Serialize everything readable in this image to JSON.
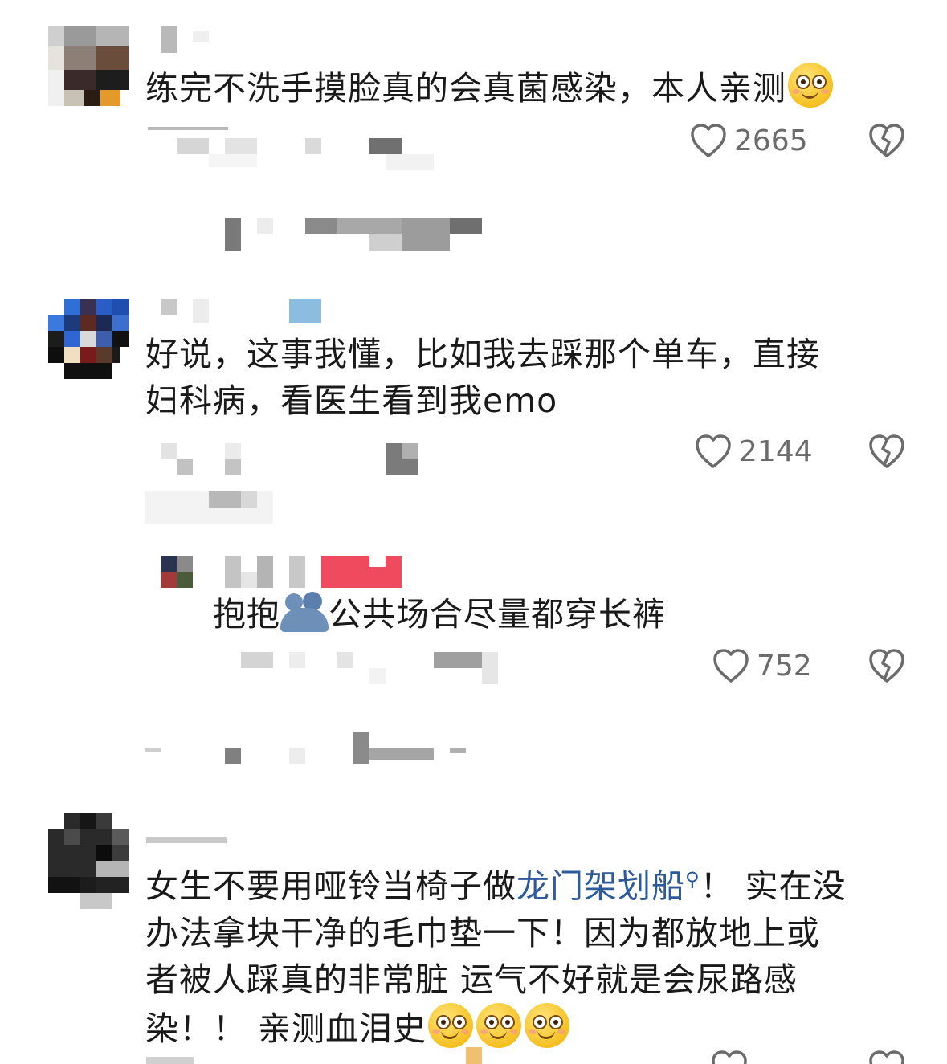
{
  "comments": [
    {
      "text": "练完不洗手摸脸真的会真菌感染，本人亲测",
      "emoji": "smiley-face-emoji",
      "likes": "2665"
    },
    {
      "line1": "好说，这事我懂，比如我去踩那个单车，直接",
      "line2": "妇科病，看医生看到我emo",
      "likes": "2144",
      "reply": {
        "before": "抱抱",
        "emoji": "hug-emoji",
        "after": "公共场合尽量都穿长裤",
        "likes": "752"
      }
    },
    {
      "line1_a": "女生不要用哑铃当椅子做",
      "line1_link": "龙门架划船",
      "line1_b": "！ 实在没",
      "line2": "办法拿块干净的毛巾垫一下！因为都放地上或",
      "line3": "者被人踩真的非常脏 运气不好就是会尿路感",
      "line4": "染！！ 亲测血泪史",
      "emojis": [
        "smiley-face-emoji",
        "smiley-face-emoji",
        "smiley-face-emoji"
      ]
    }
  ],
  "colors": {
    "text": "#1a1a1a",
    "link": "#2d5a9a",
    "meta": "#6b6b6b",
    "pixelated": "#9a9a9a"
  }
}
